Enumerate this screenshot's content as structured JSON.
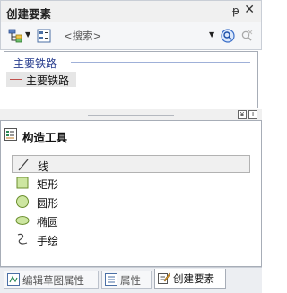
{
  "window": {
    "title": "创建要素",
    "pin_glyph": "ᵽ",
    "close_glyph": "✕"
  },
  "toolbar": {
    "organize_icon": "organize-templates-icon",
    "view_icon": "view-options-icon",
    "search_placeholder": "<搜索>",
    "search_icon": "magnifier-icon",
    "clear_search_icon": "clear-search-icon"
  },
  "templates": {
    "group_header": "主要铁路",
    "items": [
      {
        "label": "主要铁路",
        "swatch_color": "#c0504d"
      }
    ]
  },
  "splitter": {
    "collapse_glyph": "¥",
    "toggle_glyph": "I"
  },
  "construction_tools": {
    "title": "构造工具",
    "items": [
      {
        "label": "线",
        "icon": "line-icon",
        "selected": true
      },
      {
        "label": "矩形",
        "icon": "rectangle-icon",
        "selected": false
      },
      {
        "label": "圆形",
        "icon": "circle-icon",
        "selected": false
      },
      {
        "label": "椭圆",
        "icon": "ellipse-icon",
        "selected": false
      },
      {
        "label": "手绘",
        "icon": "freehand-icon",
        "selected": false
      }
    ]
  },
  "tabs": [
    {
      "label": "编辑草图属性",
      "icon": "edit-sketch-properties-icon",
      "active": false
    },
    {
      "label": "属性",
      "icon": "attributes-icon",
      "active": false
    },
    {
      "label": "创建要素",
      "icon": "create-features-icon",
      "active": true
    }
  ]
}
